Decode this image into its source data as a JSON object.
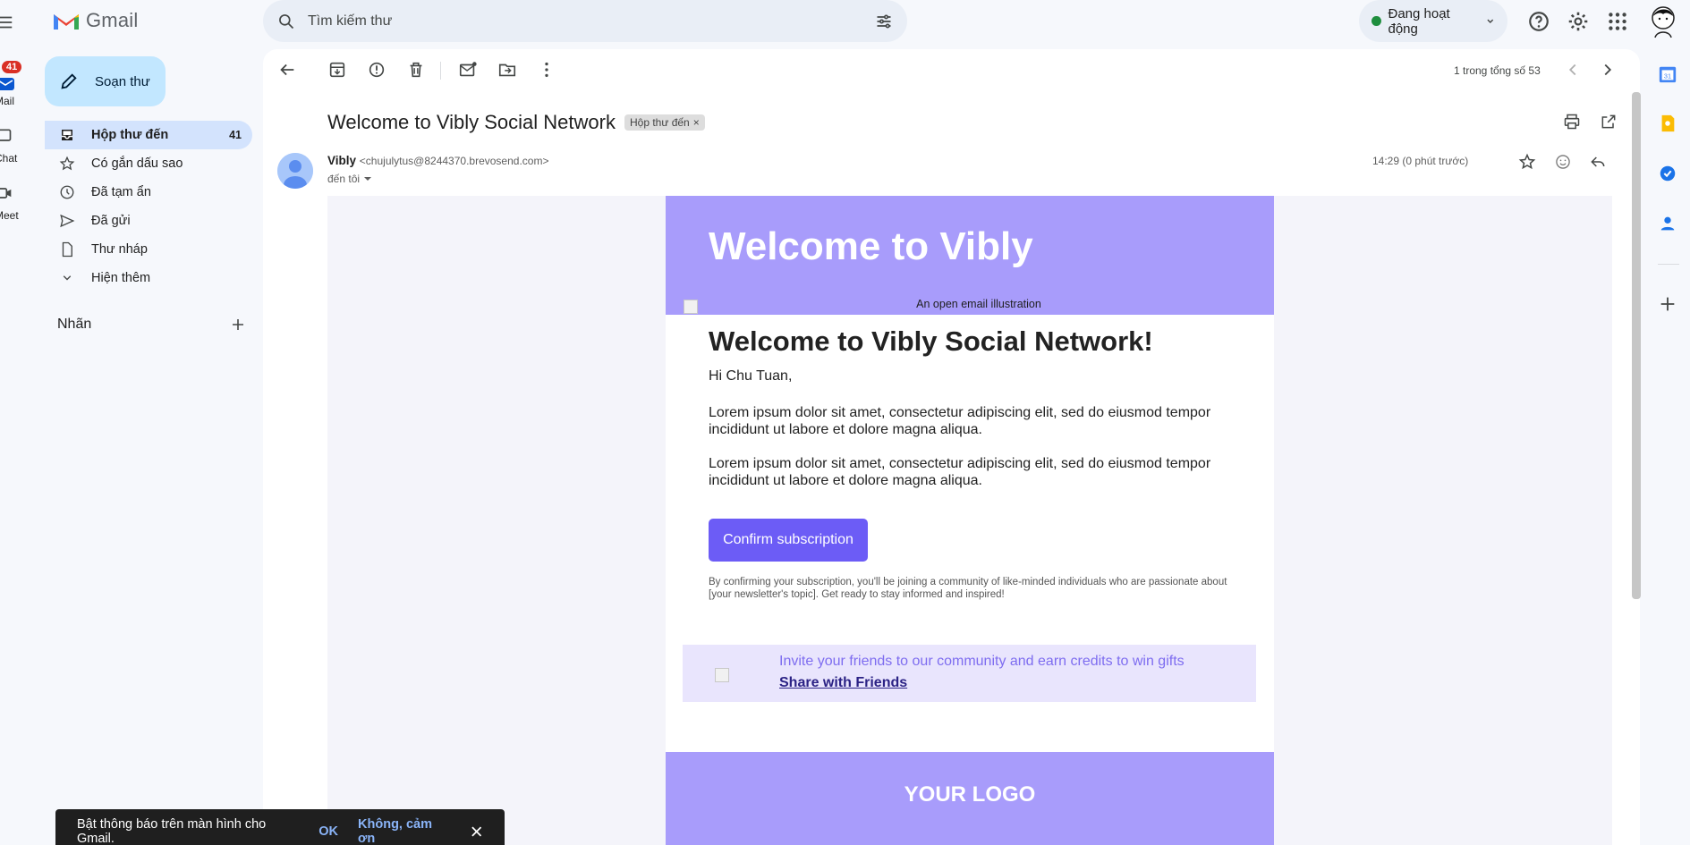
{
  "rail": {
    "badge": "41",
    "mail_label": "Mail",
    "chat_label": "Chat",
    "meet_label": "Meet"
  },
  "header": {
    "app_name": "Gmail",
    "search_placeholder": "Tìm kiếm thư",
    "status": "Đang hoạt động"
  },
  "sidebar": {
    "compose": "Soạn thư",
    "items": [
      {
        "label": "Hộp thư đến",
        "count": "41",
        "icon": "inbox-icon"
      },
      {
        "label": "Có gắn dấu sao",
        "icon": "star-icon"
      },
      {
        "label": "Đã tạm ẩn",
        "icon": "clock-icon"
      },
      {
        "label": "Đã gửi",
        "icon": "send-icon"
      },
      {
        "label": "Thư nháp",
        "icon": "draft-icon"
      },
      {
        "label": "Hiện thêm",
        "icon": "chevron-down-icon"
      }
    ],
    "labels_heading": "Nhãn"
  },
  "message": {
    "pager": "1 trong tổng số 53",
    "subject": "Welcome to Vibly Social Network",
    "chip": "Hộp thư đến",
    "sender_name": "Vibly",
    "sender_email": "<chujulytus@8244370.brevosend.com>",
    "to": "đến tôi",
    "time": "14:29 (0 phút trước)"
  },
  "email": {
    "hero_title": "Welcome to Vibly",
    "hero_alt": "An open email illustration",
    "heading": "Welcome to Vibly Social Network!",
    "greeting": "Hi Chu Tuan,",
    "para1": "Lorem ipsum dolor sit amet, consectetur adipiscing elit, sed do eiusmod tempor incididunt ut labore et dolore magna aliqua.",
    "para2": "Lorem ipsum dolor sit amet, consectetur adipiscing elit, sed do eiusmod tempor incididunt ut labore et dolore magna aliqua.",
    "confirm_button": "Confirm subscription",
    "fine_print": "By confirming your subscription, you'll be joining a community of like-minded individuals who are passionate about [your newsletter's topic]. Get ready to stay informed and inspired!",
    "invite_text": "Invite your friends to our community and earn credits to win gifts",
    "share_link": "Share with Friends",
    "footer_logo": "YOUR LOGO"
  },
  "snackbar": {
    "text": "Bật thông báo trên màn hình cho Gmail.",
    "ok": "OK",
    "no": "Không, cảm ơn"
  },
  "colors": {
    "accent": "#6c5cf6",
    "hero": "#a89cfb",
    "active_nav": "#d3e3fd",
    "compose": "#c2e7ff"
  }
}
